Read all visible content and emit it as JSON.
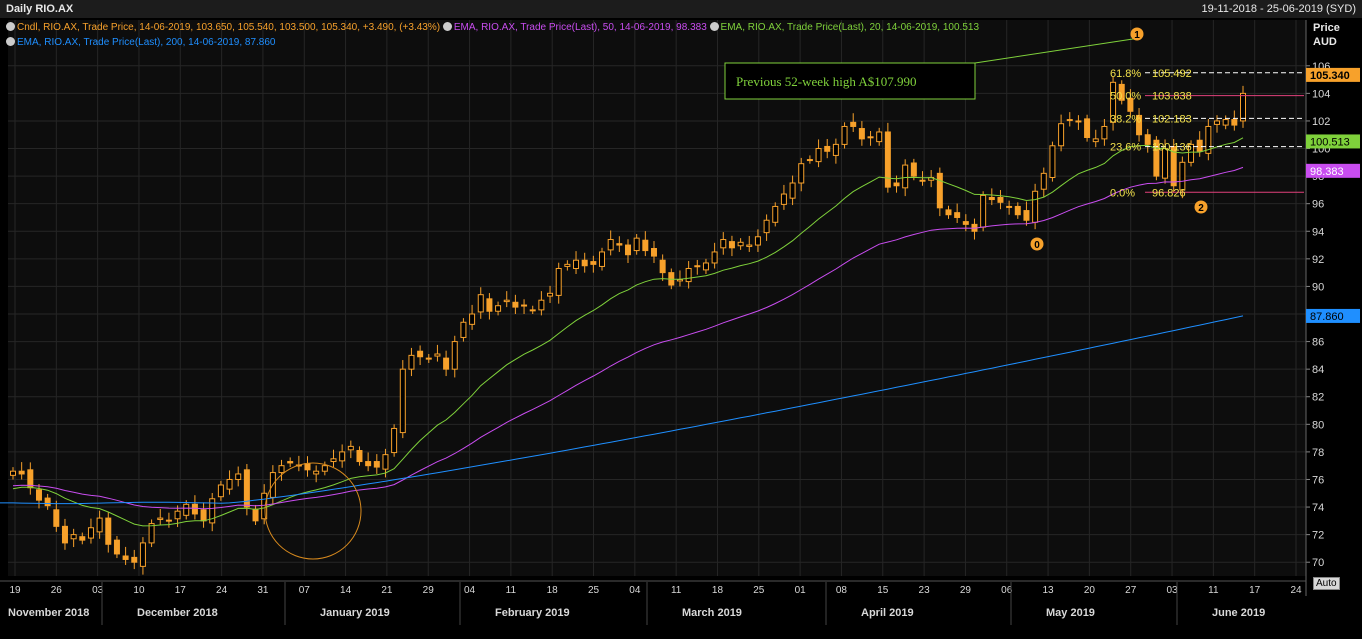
{
  "header": {
    "title": "Daily RIO.AX",
    "date_range": "19-11-2018 - 25-06-2019 (SYD)"
  },
  "legend": {
    "candle": "Cndl, RIO.AX, Trade Price, 14-06-2019, 103.650, 105.540, 103.500, 105.340, +3.490, (+3.43%)",
    "ema50": "EMA, RIO.AX, Trade Price(Last), 50, 14-06-2019, 98.383",
    "ema20": "EMA, RIO.AX, Trade Price(Last), 20, 14-06-2019, 100.513",
    "ema200": "EMA, RIO.AX, Trade Price(Last), 200, 14-06-2019, 87.860"
  },
  "axis": {
    "price_label": "Price",
    "currency_label": "AUD",
    "auto_label": "Auto"
  },
  "annotation": {
    "text": "Previous 52-week high A$107.990"
  },
  "colors": {
    "background": "#000000",
    "candle": "#f7a12b",
    "ema20": "#7fd13b",
    "ema50": "#c94df0",
    "ema200": "#1f8fff",
    "fib_dashed": "#ffffff",
    "fib_solid": "#e0407b",
    "fib_text": "#f3e24c",
    "grid": "#262626",
    "axis_text": "#d8d8d8"
  },
  "chart_data": {
    "type": "candlestick",
    "ylim": [
      69,
      107
    ],
    "y_ticks": [
      70,
      72,
      74,
      76,
      78,
      80,
      82,
      84,
      86,
      88,
      90,
      92,
      94,
      96,
      98,
      100,
      102,
      104,
      106
    ],
    "x_tick_labels": [
      "19",
      "26",
      "03",
      "10",
      "17",
      "24",
      "31",
      "07",
      "14",
      "21",
      "29",
      "04",
      "11",
      "18",
      "25",
      "04",
      "11",
      "18",
      "25",
      "01",
      "08",
      "15",
      "23",
      "29",
      "06",
      "13",
      "20",
      "27",
      "03",
      "11",
      "17",
      "24"
    ],
    "month_labels": [
      "November 2018",
      "December 2018",
      "January 2019",
      "February 2019",
      "March 2019",
      "April 2019",
      "May 2019",
      "June 2019"
    ],
    "last_candle": {
      "date": "14-06-2019",
      "open": 103.65,
      "high": 105.54,
      "low": 103.5,
      "close": 105.34,
      "change": "+3.490",
      "change_pct": "(+3.43%)"
    },
    "closes": [
      76.6,
      76.4,
      75.4,
      74.5,
      74.1,
      72.6,
      71.4,
      72.0,
      71.6,
      72.5,
      73.2,
      71.3,
      70.6,
      70.2,
      70.0,
      71.4,
      72.8,
      73.2,
      73.0,
      73.7,
      74.2,
      73.5,
      73.0,
      74.6,
      75.6,
      76.0,
      76.4,
      74.0,
      73.0,
      75.0,
      76.5,
      77.0,
      77.2,
      77.0,
      76.7,
      76.6,
      77.0,
      77.5,
      78.0,
      78.4,
      77.3,
      77.0,
      76.9,
      77.8,
      79.7,
      84.0,
      85.0,
      84.9,
      84.8,
      85.1,
      84.0,
      86.0,
      87.4,
      88.0,
      89.4,
      88.2,
      88.6,
      89.0,
      88.5,
      88.6,
      88.3,
      89.0,
      89.5,
      91.3,
      91.6,
      91.9,
      91.5,
      91.6,
      92.5,
      93.4,
      93.0,
      92.3,
      93.5,
      92.6,
      92.2,
      91.0,
      90.1,
      90.5,
      91.3,
      91.5,
      91.7,
      92.5,
      93.4,
      92.8,
      93.2,
      93.0,
      93.6,
      94.8,
      95.8,
      96.7,
      97.5,
      98.9,
      99.2,
      100.0,
      99.8,
      100.3,
      101.6,
      101.6,
      100.7,
      100.8,
      101.2,
      97.2,
      97.3,
      98.8,
      98.0,
      97.7,
      97.9,
      95.7,
      95.2,
      95.0,
      94.5,
      94.0,
      96.6,
      96.3,
      96.1,
      95.8,
      95.2,
      94.8,
      96.9,
      98.2,
      100.2,
      101.8,
      102.1,
      102.0,
      100.8,
      100.7,
      101.6,
      104.8,
      103.5,
      102.7,
      101.0,
      100.3,
      98.0,
      100.0,
      97.3,
      99.0,
      100.3,
      99.8,
      101.6,
      102.0,
      102.1,
      101.7,
      104.0
    ],
    "levels": {
      "previous_52_week_high": 107.99,
      "ema20_last": 100.513,
      "ema50_last": 98.383,
      "ema200_last": 87.86,
      "last_price": 105.34
    },
    "fibonacci": [
      {
        "pct": "61.8%",
        "value": "105.492",
        "level": 105.492
      },
      {
        "pct": "50.0%",
        "value": "103.838",
        "level": 103.838
      },
      {
        "pct": "38.2%",
        "value": "102.183",
        "level": 102.183
      },
      {
        "pct": "23.6%",
        "value": "100.136",
        "level": 100.136
      },
      {
        "pct": "0.0%",
        "value": "96.826",
        "level": 96.826
      }
    ],
    "wave_markers": [
      "1",
      "0",
      "2"
    ],
    "price_tags": [
      {
        "value": "105.340",
        "level": 105.34,
        "bg": "#f7a12b",
        "fg": "#000000"
      },
      {
        "value": "100.513",
        "level": 100.513,
        "bg": "#7fd13b",
        "fg": "#000000"
      },
      {
        "value": "98.383",
        "level": 98.383,
        "bg": "#c94df0",
        "fg": "#ffffff"
      },
      {
        "value": "87.860",
        "level": 87.86,
        "bg": "#1f8fff",
        "fg": "#000000"
      }
    ]
  }
}
